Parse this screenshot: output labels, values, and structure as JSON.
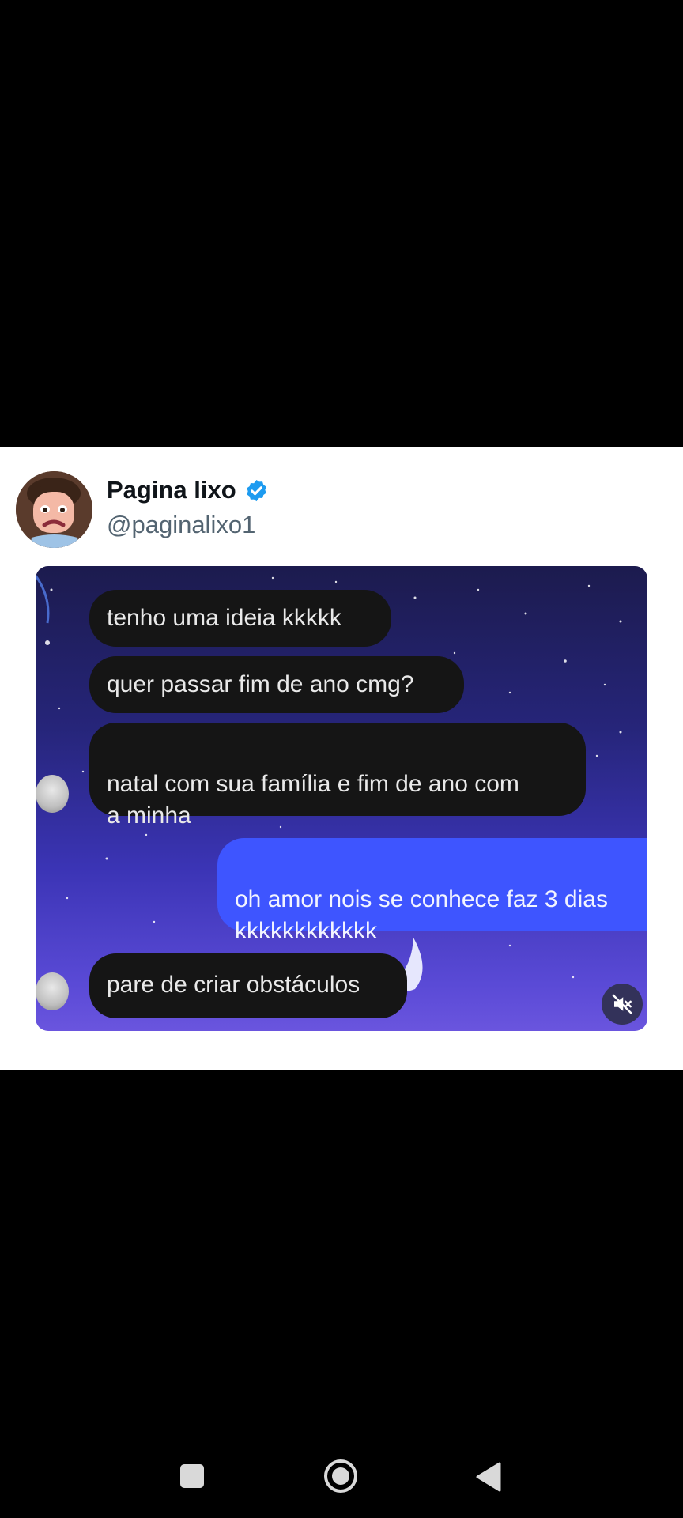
{
  "tweet": {
    "author_name": "Pagina lixo",
    "author_handle": "@paginalixo1"
  },
  "chat": {
    "messages": [
      {
        "text": "tenho uma ideia kkkkk",
        "side": "received"
      },
      {
        "text": "quer passar fim de ano cmg?",
        "side": "received"
      },
      {
        "text": "natal com sua família e fim de ano com\na minha",
        "side": "received"
      },
      {
        "text": "oh amor nois se conhece faz 3 dias\nkkkkkkkkkkkk",
        "side": "sent"
      },
      {
        "text": "pare de criar obstáculos",
        "side": "received"
      }
    ]
  },
  "media_controls": {
    "mute_icon": "muted-speaker-icon"
  },
  "nav": {
    "icons": [
      "recents-square-icon",
      "home-circle-icon",
      "back-triangle-icon"
    ]
  },
  "colors": {
    "verified": "#1d9bf0",
    "sent_bubble": "#3e55ff",
    "received_bubble": "#151515"
  }
}
